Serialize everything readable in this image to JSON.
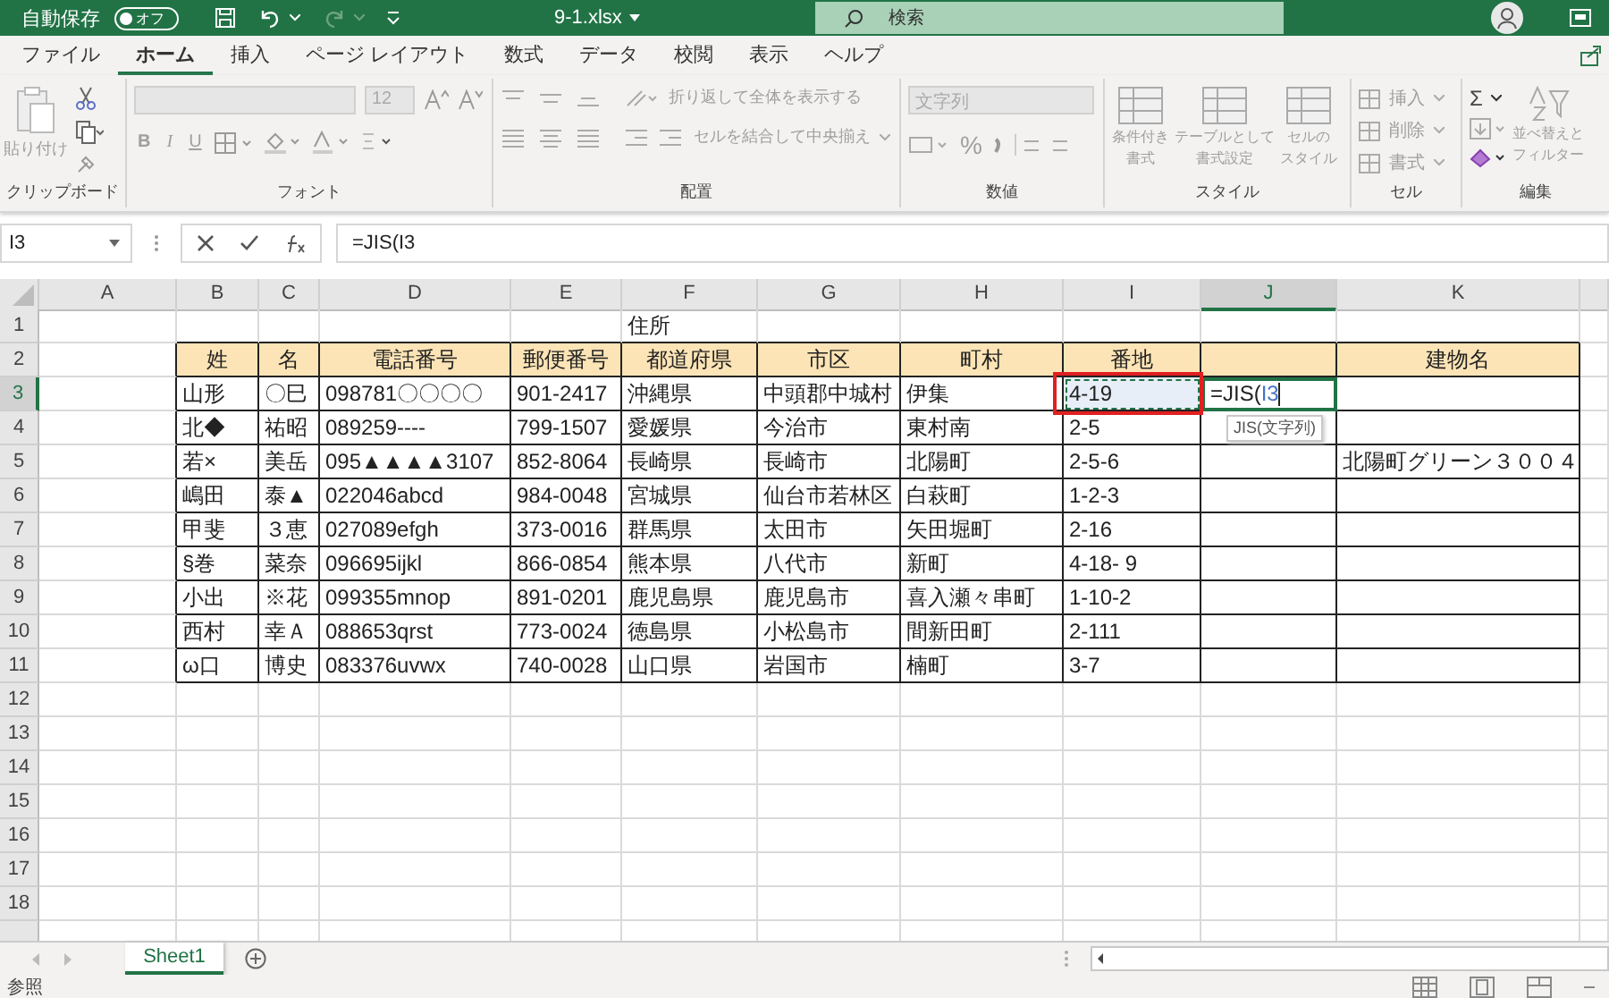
{
  "title_bar": {
    "autosave_label": "自動保存",
    "autosave_toggle": {
      "label": "オフ",
      "on": false
    },
    "filename": "9-1.xlsx",
    "search_placeholder": "検索"
  },
  "menu_tabs": [
    {
      "label": "ファイル",
      "selected": false
    },
    {
      "label": "ホーム",
      "selected": true
    },
    {
      "label": "挿入",
      "selected": false
    },
    {
      "label": "ページ レイアウト",
      "selected": false
    },
    {
      "label": "数式",
      "selected": false
    },
    {
      "label": "データ",
      "selected": false
    },
    {
      "label": "校閲",
      "selected": false
    },
    {
      "label": "表示",
      "selected": false
    },
    {
      "label": "ヘルプ",
      "selected": false
    }
  ],
  "ribbon": {
    "disabled": true,
    "groups": [
      {
        "name": "クリップボード",
        "kind": "clipboard",
        "paste_label": "貼り付け"
      },
      {
        "name": "フォント",
        "kind": "font",
        "font_size": "12",
        "buttons": [
          "B",
          "I",
          "U"
        ]
      },
      {
        "name": "配置",
        "kind": "alignment",
        "wrap_label": "折り返して全体を表示する",
        "merge_label": "セルを結合して中央揃え"
      },
      {
        "name": "数値",
        "kind": "number",
        "format": "文字列",
        "percent": "%"
      },
      {
        "name": "スタイル",
        "kind": "styles",
        "items": [
          [
            "条件付き",
            "書式"
          ],
          [
            "テーブルとして",
            "書式設定"
          ],
          [
            "セルの",
            "スタイル"
          ]
        ]
      },
      {
        "name": "セル",
        "kind": "cells",
        "items": [
          "挿入",
          "削除",
          "書式"
        ]
      },
      {
        "name": "編集",
        "kind": "editing",
        "sum": "Σ",
        "sort_label": [
          "並べ替えと",
          "フィルター"
        ]
      }
    ]
  },
  "formula_bar": {
    "name_box": "I3",
    "formula": "=JIS(I3"
  },
  "sheet": {
    "columns": [
      {
        "label": "A",
        "selected": false
      },
      {
        "label": "B",
        "selected": false
      },
      {
        "label": "C",
        "selected": false
      },
      {
        "label": "D",
        "selected": false
      },
      {
        "label": "E",
        "selected": false
      },
      {
        "label": "F",
        "selected": false
      },
      {
        "label": "G",
        "selected": false
      },
      {
        "label": "H",
        "selected": false
      },
      {
        "label": "I",
        "selected": false
      },
      {
        "label": "J",
        "selected": true
      },
      {
        "label": "K",
        "selected": false
      }
    ],
    "rows": [
      {
        "number": "1",
        "selected": false,
        "kind": "plain",
        "cells": {
          "F": "住所"
        }
      },
      {
        "number": "2",
        "selected": false,
        "kind": "header",
        "cells": {
          "B": "姓",
          "C": "名",
          "D": "電話番号",
          "E": "郵便番号",
          "F": "都道府県",
          "G": "市区",
          "H": "町村",
          "I": "番地",
          "K": "建物名"
        }
      },
      {
        "number": "3",
        "selected": true,
        "kind": "data",
        "cells": {
          "B": "山形",
          "C": "〇巳",
          "D": "098781〇〇〇〇",
          "E": "901-2417",
          "F": "沖縄県",
          "G": "中頭郡中城村",
          "H": "伊集",
          "I": {
            "text": "4-19",
            "referenced": true,
            "annotated": true
          },
          "J": {
            "text": "=JIS(",
            "reference": "I3",
            "editing": true
          }
        }
      },
      {
        "number": "4",
        "selected": false,
        "kind": "data",
        "cells": {
          "B": "北◆",
          "C": "祐昭",
          "D": "089259----",
          "E": "799-1507",
          "F": "愛媛県",
          "G": "今治市",
          "H": "東村南",
          "I": "2-5"
        }
      },
      {
        "number": "5",
        "selected": false,
        "kind": "data",
        "cells": {
          "B": "若×",
          "C": "美岳",
          "D": "095▲▲▲▲3107",
          "E": "852-8064",
          "F": "長崎県",
          "G": "長崎市",
          "H": "北陽町",
          "I": "2-5-6",
          "K": "北陽町グリーン３００４"
        }
      },
      {
        "number": "6",
        "selected": false,
        "kind": "data",
        "cells": {
          "B": "嶋田",
          "C": "泰▲",
          "D": "022046abcd",
          "E": "984-0048",
          "F": "宮城県",
          "G": "仙台市若林区",
          "H": "白萩町",
          "I": "1-2-3"
        }
      },
      {
        "number": "7",
        "selected": false,
        "kind": "data",
        "cells": {
          "B": "甲斐",
          "C": "３恵",
          "D": "027089efgh",
          "E": "373-0016",
          "F": "群馬県",
          "G": "太田市",
          "H": "矢田堀町",
          "I": "2-16"
        }
      },
      {
        "number": "8",
        "selected": false,
        "kind": "data",
        "cells": {
          "B": "§巻",
          "C": "菜奈",
          "D": "096695ijkl",
          "E": "866-0854",
          "F": "熊本県",
          "G": "八代市",
          "H": "新町",
          "I": "4-18- 9"
        }
      },
      {
        "number": "9",
        "selected": false,
        "kind": "data",
        "cells": {
          "B": "小出",
          "C": "※花",
          "D": "099355mnop",
          "E": "891-0201",
          "F": "鹿児島県",
          "G": "鹿児島市",
          "H": "喜入瀬々串町",
          "I": "1-10-2"
        }
      },
      {
        "number": "10",
        "selected": false,
        "kind": "data",
        "cells": {
          "B": "西村",
          "C": "幸Ａ",
          "D": "088653qrst",
          "E": "773-0024",
          "F": "徳島県",
          "G": "小松島市",
          "H": "間新田町",
          "I": "2-111"
        }
      },
      {
        "number": "11",
        "selected": false,
        "kind": "data",
        "cells": {
          "B": "ω口",
          "C": "博史",
          "D": "083376uvwx",
          "E": "740-0028",
          "F": "山口県",
          "G": "岩国市",
          "H": "楠町",
          "I": "3-7"
        }
      },
      {
        "number": "12",
        "selected": false,
        "kind": "plain"
      },
      {
        "number": "13",
        "selected": false,
        "kind": "plain"
      },
      {
        "number": "14",
        "selected": false,
        "kind": "plain"
      },
      {
        "number": "15",
        "selected": false,
        "kind": "plain"
      },
      {
        "number": "16",
        "selected": false,
        "kind": "plain"
      },
      {
        "number": "17",
        "selected": false,
        "kind": "plain"
      },
      {
        "number": "18",
        "selected": false,
        "kind": "plain"
      }
    ],
    "tooltip": "JIS(文字列)"
  },
  "sheet_tabs": [
    {
      "label": "Sheet1",
      "selected": true
    }
  ],
  "status_bar": {
    "mode": "参照"
  }
}
